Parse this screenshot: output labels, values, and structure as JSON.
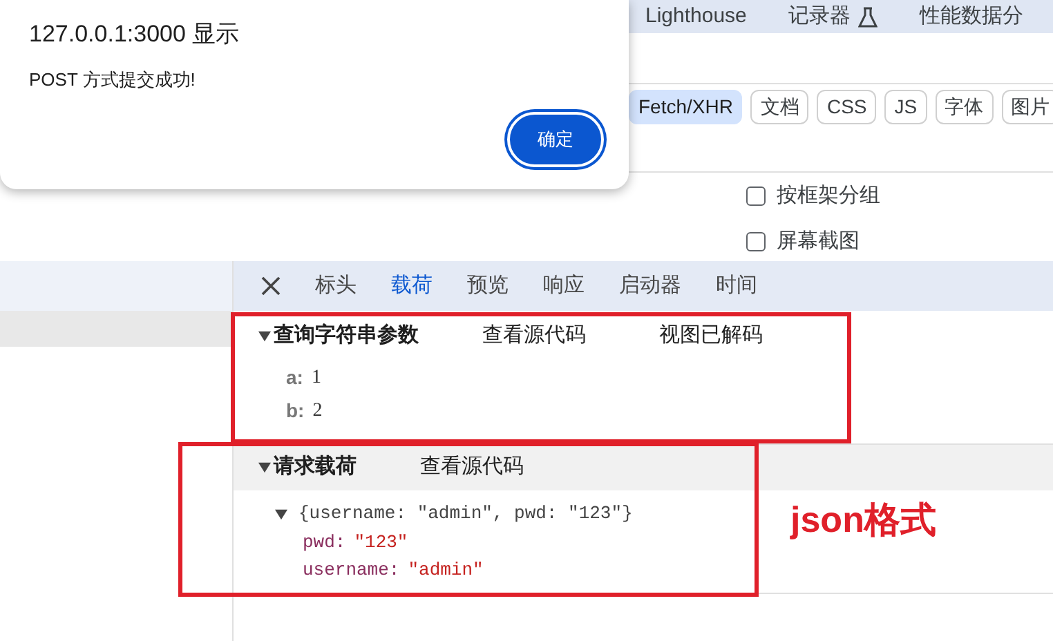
{
  "panel_tabs": [
    {
      "label": "Lighthouse",
      "experimental": false
    },
    {
      "label": "记录器",
      "experimental": true
    },
    {
      "label": "性能数据分",
      "experimental": false
    }
  ],
  "filters": [
    {
      "label": "Fetch/XHR",
      "selected": true
    },
    {
      "label": "文档",
      "selected": false
    },
    {
      "label": "CSS",
      "selected": false
    },
    {
      "label": "JS",
      "selected": false
    },
    {
      "label": "字体",
      "selected": false
    },
    {
      "label": "图片",
      "selected": false
    }
  ],
  "options": [
    {
      "label": "按框架分组",
      "checked": false
    },
    {
      "label": "屏幕截图",
      "checked": false
    }
  ],
  "detail_tabs": [
    {
      "label": "标头",
      "selected": false
    },
    {
      "label": "载荷",
      "selected": true
    },
    {
      "label": "预览",
      "selected": false
    },
    {
      "label": "响应",
      "selected": false
    },
    {
      "label": "启动器",
      "selected": false
    },
    {
      "label": "时间",
      "selected": false
    }
  ],
  "query_section": {
    "title": "查询字符串参数",
    "expanded": true,
    "links": [
      "查看源代码",
      "视图已解码"
    ],
    "params": [
      {
        "key": "a:",
        "value": "1"
      },
      {
        "key": "b:",
        "value": "2"
      }
    ]
  },
  "payload_section": {
    "title": "请求载荷",
    "expanded": true,
    "links": [
      "查看源代码"
    ],
    "object": {
      "summary": "{username: \"admin\", pwd: \"123\"}",
      "expanded": true,
      "properties": [
        {
          "key": "pwd:",
          "value": "\"123\""
        },
        {
          "key": "username:",
          "value": "\"admin\""
        }
      ]
    }
  },
  "annotation": "json格式",
  "dialog": {
    "title": "127.0.0.1:3000 显示",
    "message": "POST 方式提交成功!",
    "button": "确定"
  }
}
